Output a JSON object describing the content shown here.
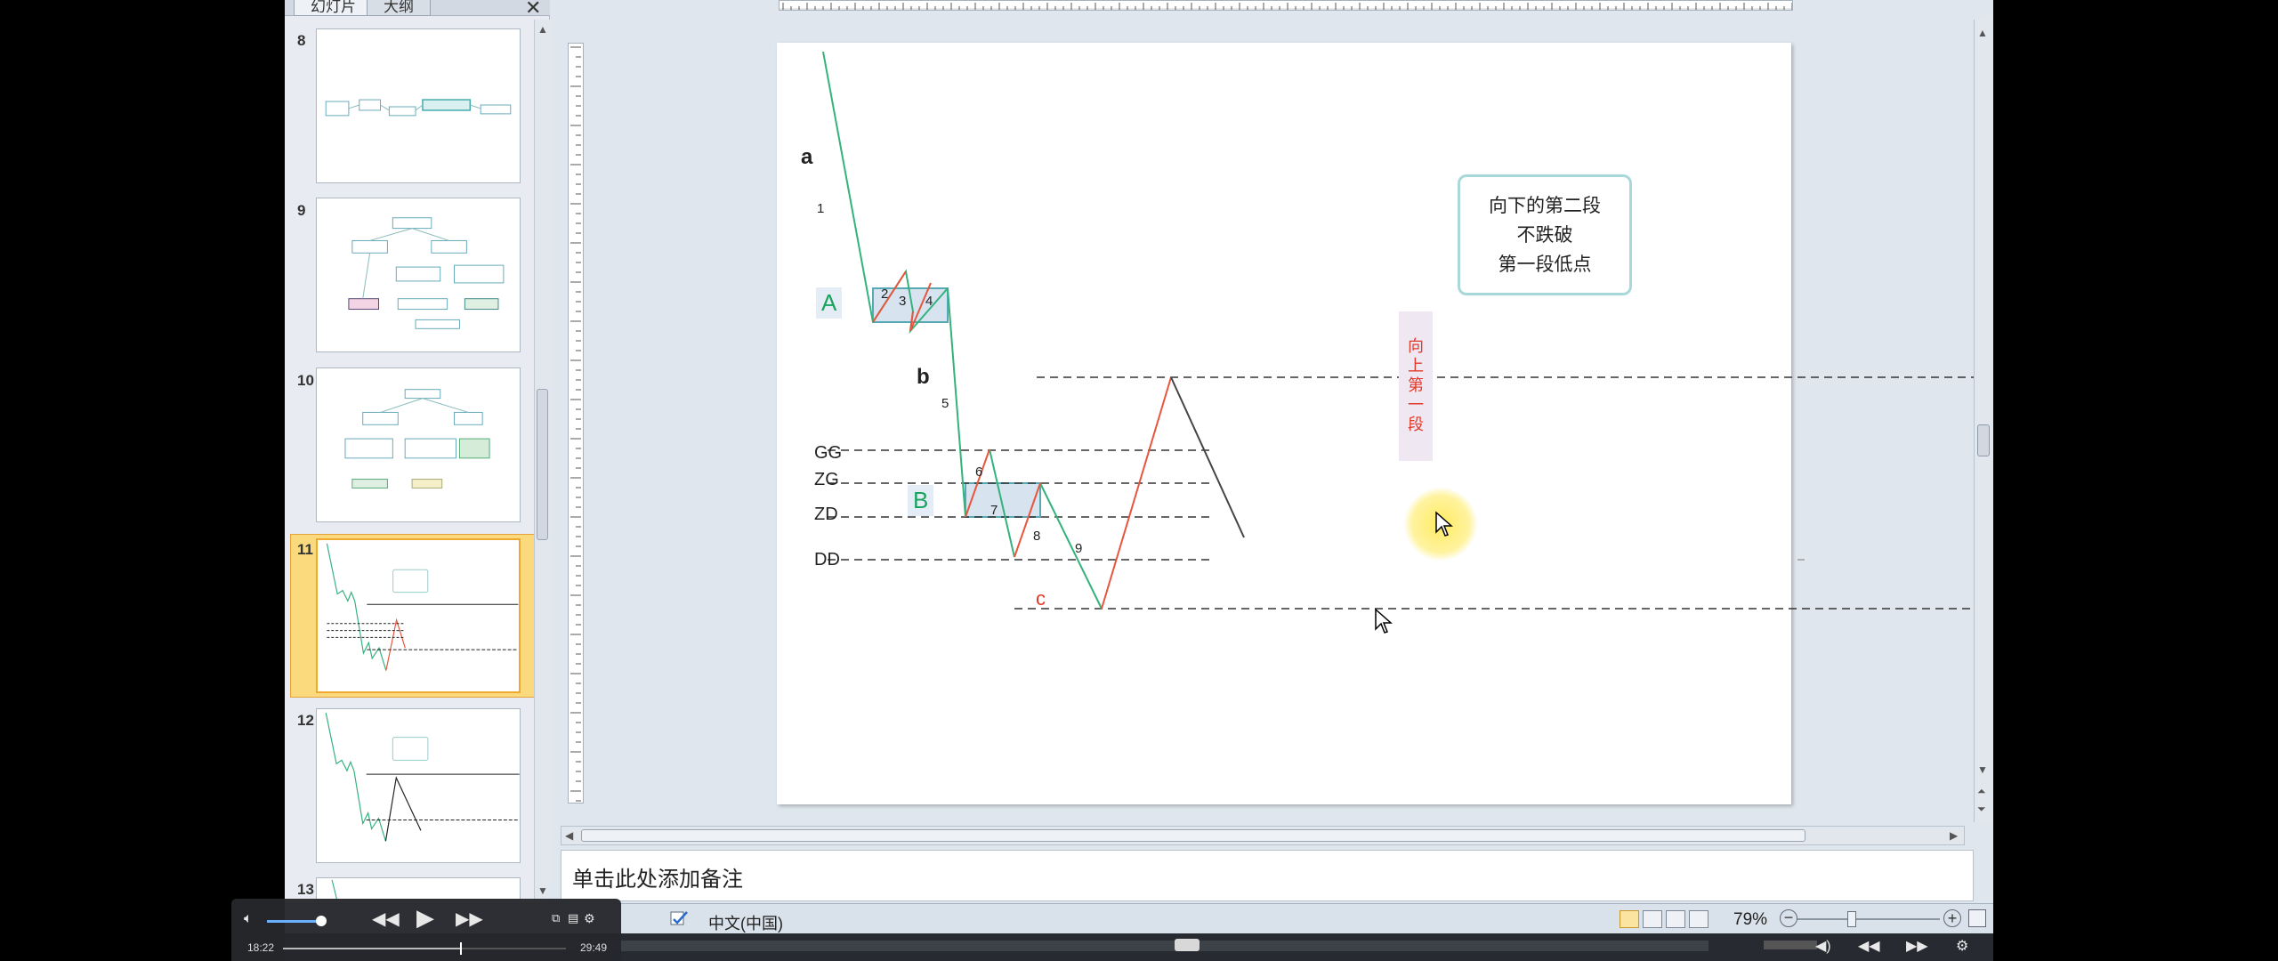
{
  "panel": {
    "tab_slides": "幻灯片",
    "tab_outline": "大纲",
    "close": "✕"
  },
  "thumbnails": [
    {
      "num": "8"
    },
    {
      "num": "9"
    },
    {
      "num": "10"
    },
    {
      "num": "11",
      "selected": true
    },
    {
      "num": "12"
    },
    {
      "num": "13"
    }
  ],
  "slide": {
    "label_a": "a",
    "label_A": "A",
    "label_b": "b",
    "label_B": "B",
    "label_c": "c",
    "gg": "GG",
    "zg": "ZG",
    "zd": "ZD",
    "dd": "DD",
    "n1": "1",
    "n2": "2",
    "n3": "3",
    "n4": "4",
    "n5": "5",
    "n6": "6",
    "n7": "7",
    "n8": "8",
    "n9": "9",
    "callout_line1": "向下的第二段",
    "callout_line2": "不跌破",
    "callout_line3": "第一段低点",
    "up_label_1": "向",
    "up_label_2": "上",
    "up_label_3": "第",
    "up_label_4": "一",
    "up_label_5": "段"
  },
  "notes": {
    "placeholder": "单击此处添加备注"
  },
  "status": {
    "language": "中文(中国)",
    "zoom": "79%"
  },
  "player": {
    "current_time": "18:22",
    "total_time": "29:49"
  },
  "colors": {
    "down_line": "#33b27d",
    "up_line": "#e8553f",
    "box_fill": "#d7e3ef",
    "box_stroke": "#59a8b6",
    "label_green": "#1aa35e",
    "label_red": "#e23a2a",
    "selection": "#fbd97d"
  }
}
